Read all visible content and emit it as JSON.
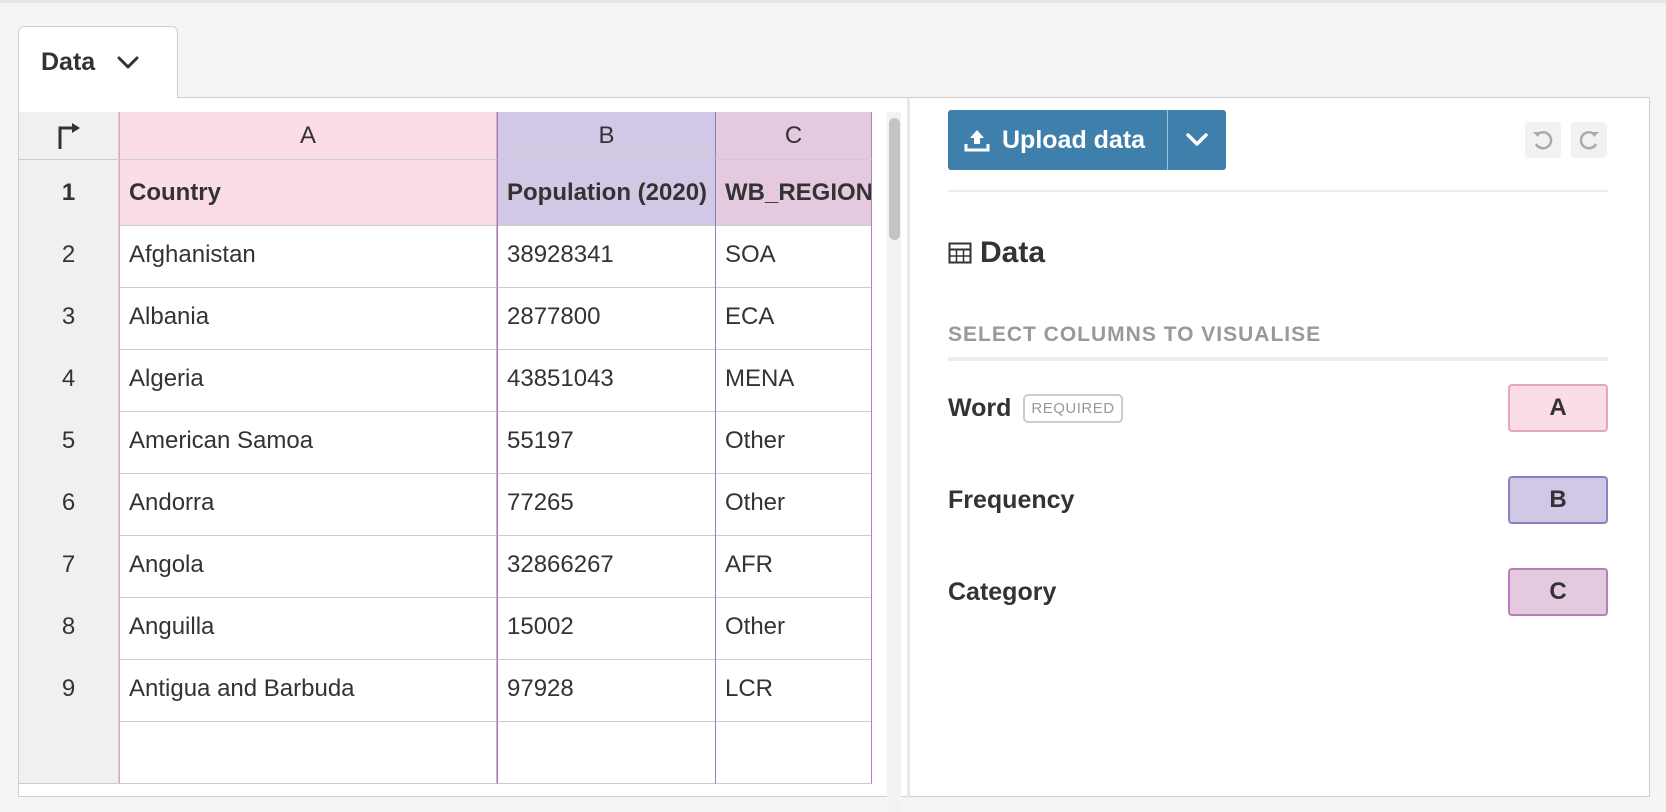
{
  "tab": {
    "label": "Data"
  },
  "grid": {
    "columns": [
      "A",
      "B",
      "C"
    ],
    "rows": [
      {
        "index": "1",
        "a": "Country",
        "b": "Population (2020)",
        "c": "WB_REGION"
      },
      {
        "index": "2",
        "a": "Afghanistan",
        "b": "38928341",
        "c": "SOA"
      },
      {
        "index": "3",
        "a": "Albania",
        "b": "2877800",
        "c": "ECA"
      },
      {
        "index": "4",
        "a": "Algeria",
        "b": "43851043",
        "c": "MENA"
      },
      {
        "index": "5",
        "a": "American Samoa",
        "b": "55197",
        "c": "Other"
      },
      {
        "index": "6",
        "a": "Andorra",
        "b": "77265",
        "c": "Other"
      },
      {
        "index": "7",
        "a": "Angola",
        "b": "32866267",
        "c": "AFR"
      },
      {
        "index": "8",
        "a": "Anguilla",
        "b": "15002",
        "c": "Other"
      },
      {
        "index": "9",
        "a": "Antigua and Barbuda",
        "b": "97928",
        "c": "LCR"
      }
    ]
  },
  "toolbar": {
    "upload_label": "Upload data"
  },
  "data_panel": {
    "title": "Data",
    "section_label": "SELECT COLUMNS TO VISUALISE",
    "fields": [
      {
        "label": "Word",
        "badge": "REQUIRED",
        "column": "A"
      },
      {
        "label": "Frequency",
        "column": "B"
      },
      {
        "label": "Category",
        "column": "C"
      }
    ]
  },
  "colors": {
    "accent": "#3f7fab",
    "column_a": "#fbdde7",
    "column_b": "#d1c8e6",
    "column_c": "#e5c9df"
  }
}
